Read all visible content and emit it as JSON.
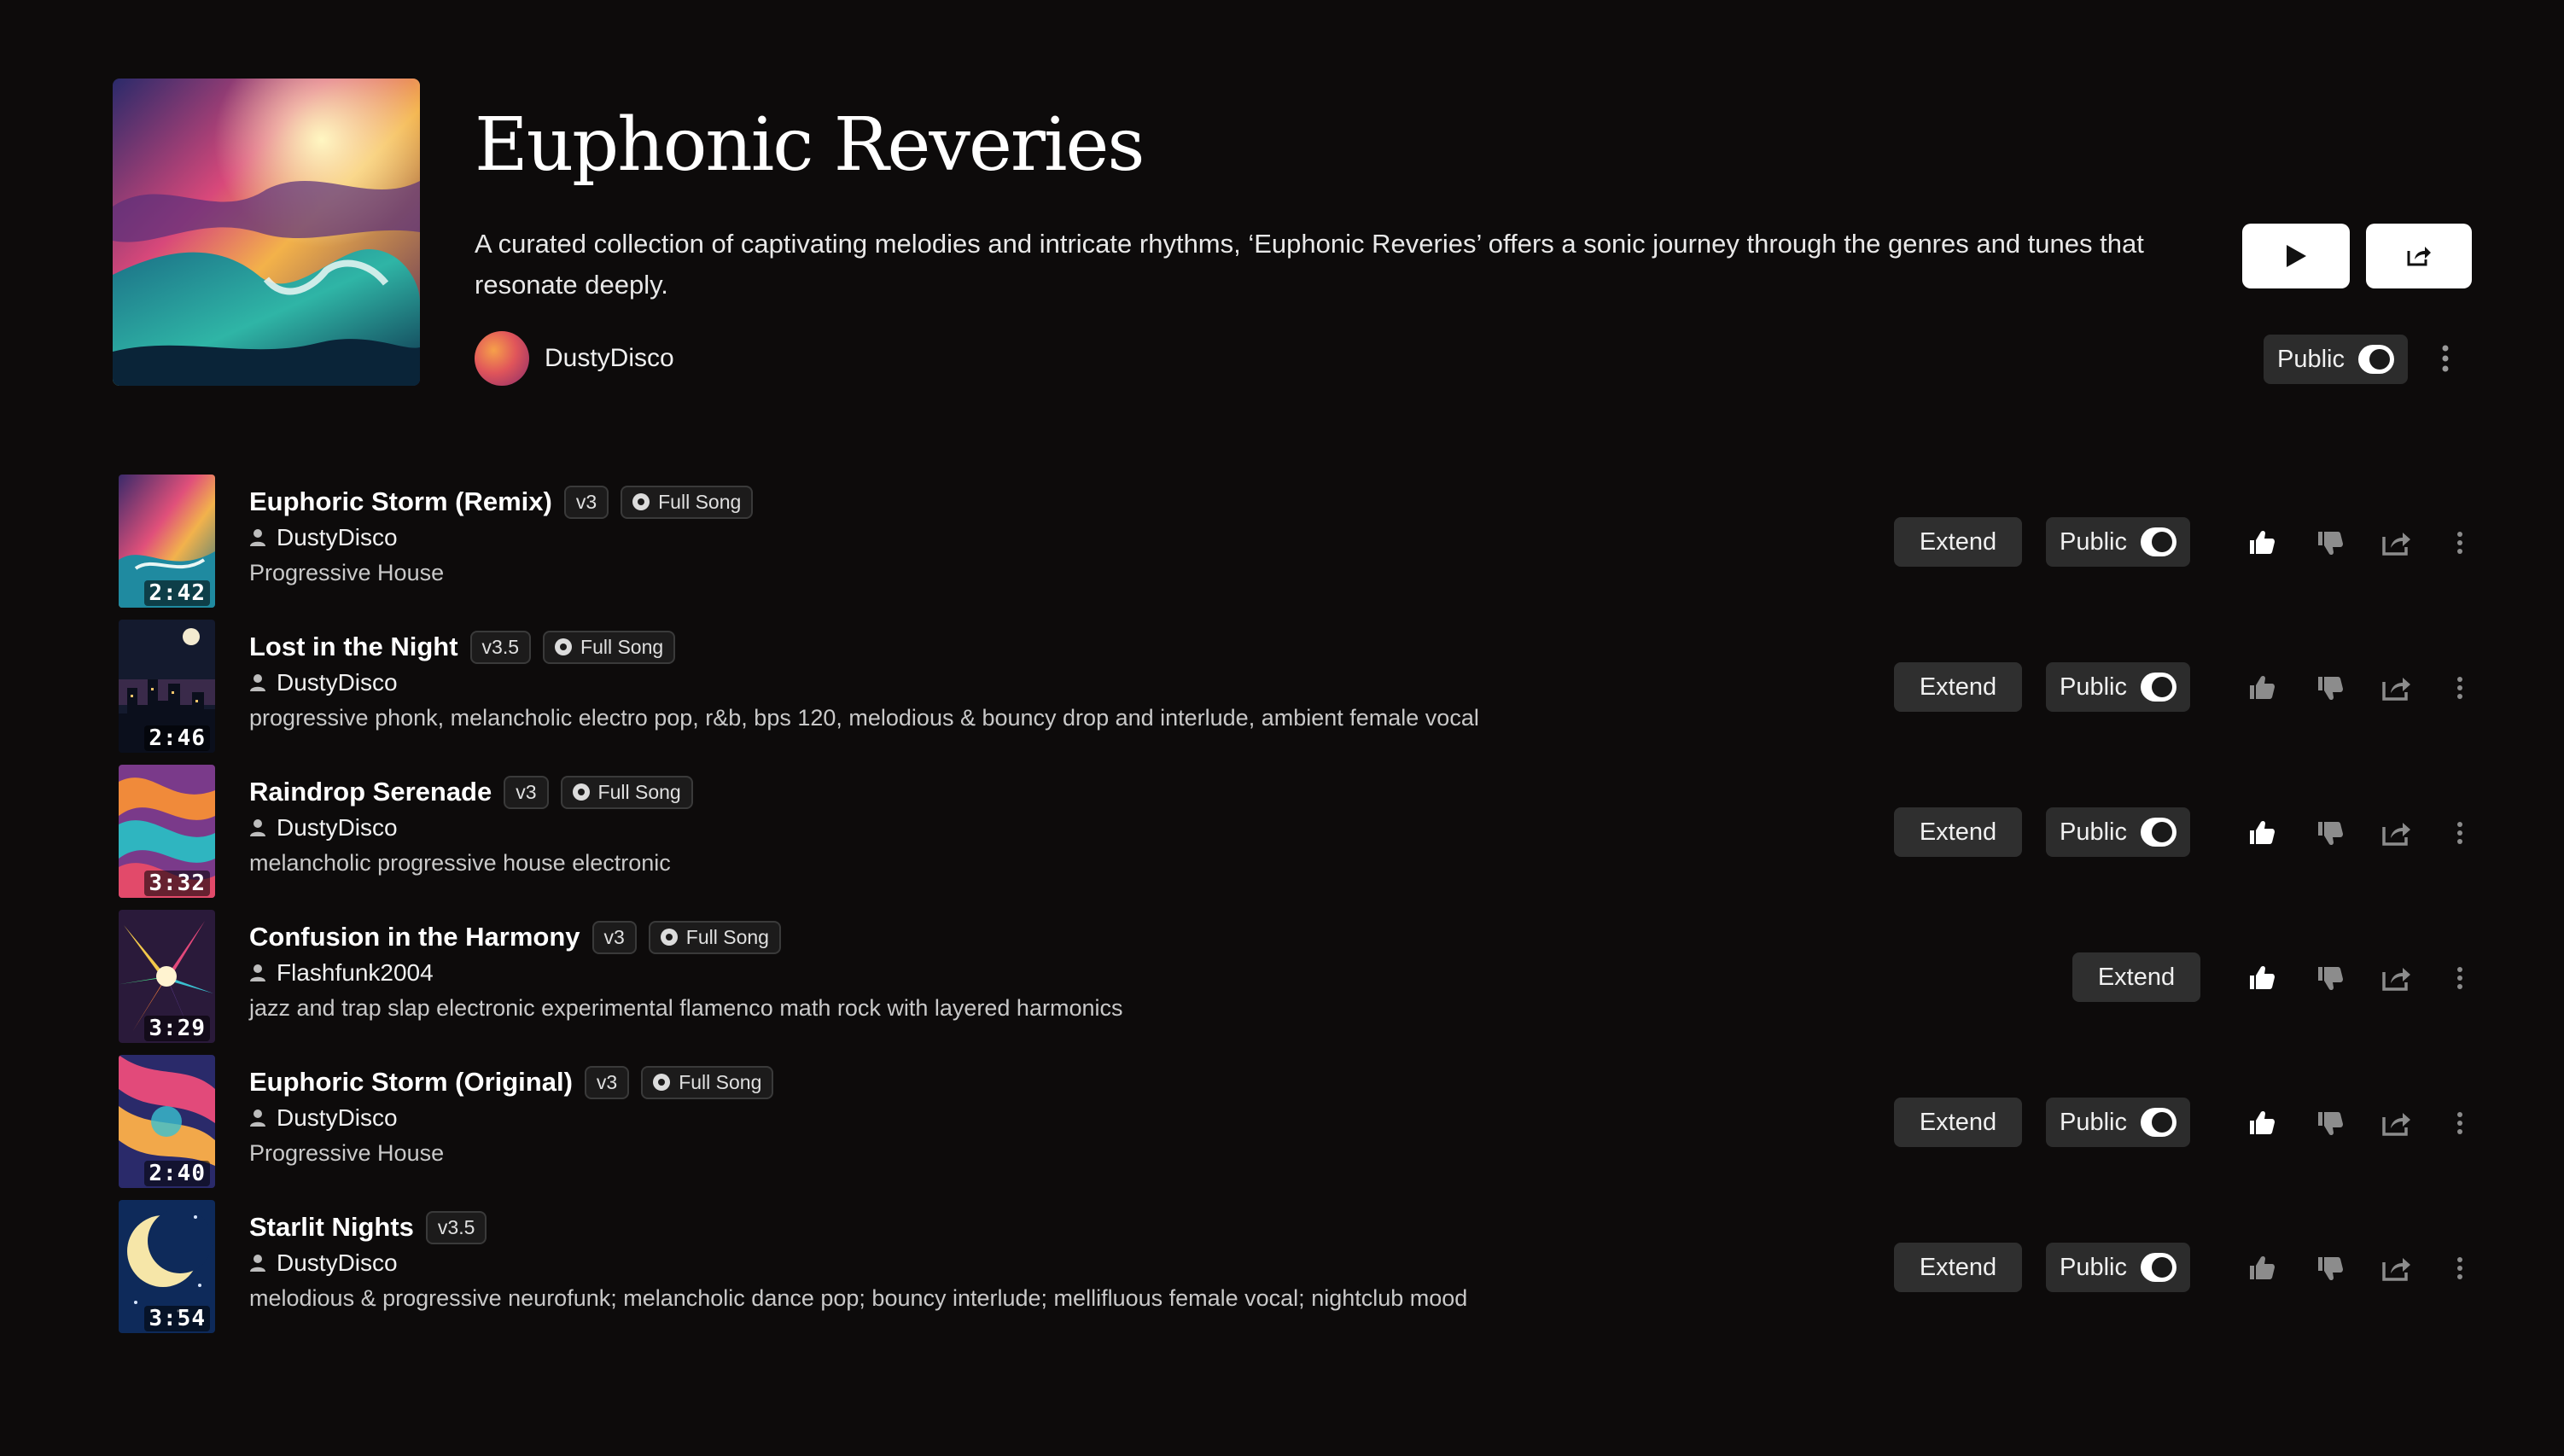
{
  "playlist": {
    "title": "Euphonic Reveries",
    "description": "A curated collection of captivating melodies and intricate rhythms, ‘Euphonic Reveries’ offers a sonic journey through the genres and tunes that resonate deeply.",
    "creator": "DustyDisco",
    "visibility_label": "Public",
    "visibility_on": true
  },
  "icons": {
    "play": "play-icon",
    "share": "share-icon",
    "more": "more-vertical-icon",
    "like": "thumbs-up-icon",
    "dislike": "thumbs-down-icon",
    "user": "user-icon",
    "full_song": "disc-icon"
  },
  "labels": {
    "extend": "Extend",
    "public": "Public",
    "full_song": "Full Song"
  },
  "songs": [
    {
      "title": "Euphoric Storm (Remix)",
      "version": "v3",
      "type": "Full Song",
      "author": "DustyDisco",
      "description": "Progressive House",
      "duration": "2:42",
      "has_public_toggle": true,
      "liked": true
    },
    {
      "title": "Lost in the Night",
      "version": "v3.5",
      "type": "Full Song",
      "author": "DustyDisco",
      "description": "progressive phonk, melancholic electro pop, r&b, bps 120, melodious & bouncy drop and interlude, ambient female vocal",
      "duration": "2:46",
      "has_public_toggle": true,
      "liked": false
    },
    {
      "title": "Raindrop Serenade",
      "version": "v3",
      "type": "Full Song",
      "author": "DustyDisco",
      "description": "melancholic progressive house electronic",
      "duration": "3:32",
      "has_public_toggle": true,
      "liked": true
    },
    {
      "title": "Confusion in the Harmony",
      "version": "v3",
      "type": "Full Song",
      "author": "Flashfunk2004",
      "description": "jazz and trap slap electronic experimental flamenco math rock with layered harmonics",
      "duration": "3:29",
      "has_public_toggle": false,
      "liked": true
    },
    {
      "title": "Euphoric Storm (Original)",
      "version": "v3",
      "type": "Full Song",
      "author": "DustyDisco",
      "description": "Progressive House",
      "duration": "2:40",
      "has_public_toggle": true,
      "liked": true
    },
    {
      "title": "Starlit Nights",
      "version": "v3.5",
      "type": "",
      "author": "DustyDisco",
      "description": "melodious & progressive neurofunk; melancholic dance pop; bouncy interlude; mellifluous female vocal; nightclub mood",
      "duration": "3:54",
      "has_public_toggle": true,
      "liked": false
    }
  ]
}
